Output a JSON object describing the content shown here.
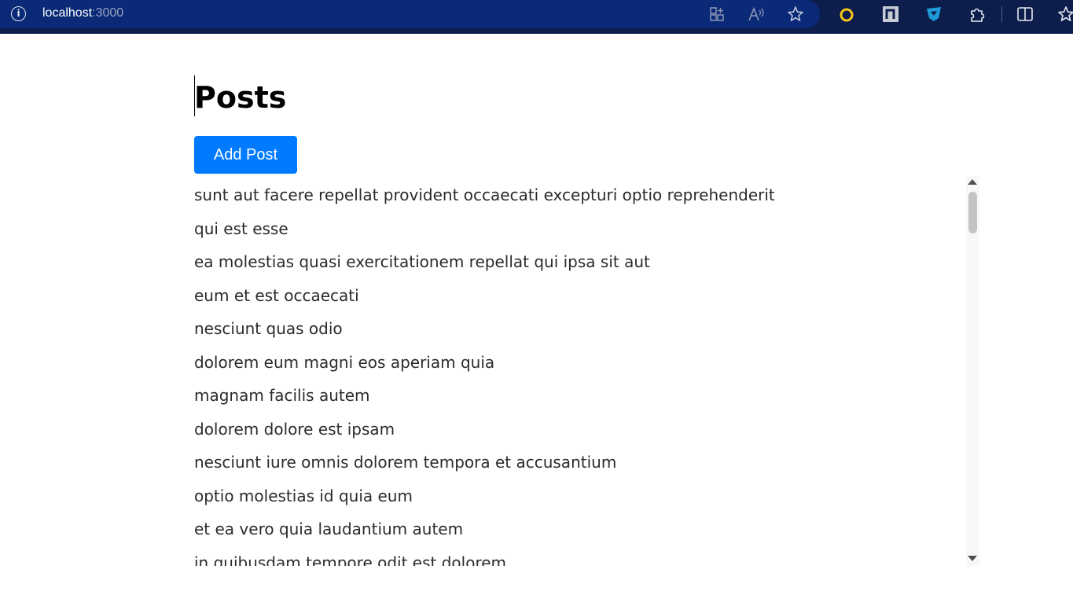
{
  "browser": {
    "url_host": "localhost",
    "url_port": ":3000",
    "info_icon": "i",
    "icons": [
      "split-screen-icon",
      "read-aloud-icon",
      "favorite-star-icon",
      "extension-ring-icon",
      "extension-n-icon",
      "extension-shield-icon",
      "extensions-puzzle-icon",
      "split-view-icon",
      "favorites-icon"
    ],
    "colors": {
      "bar": "#0d1e4d",
      "address": "#0a2a78"
    }
  },
  "page": {
    "title": "Posts",
    "add_button_label": "Add Post",
    "accent_color": "#007bff",
    "posts": [
      "sunt aut facere repellat provident occaecati excepturi optio reprehenderit",
      "qui est esse",
      "ea molestias quasi exercitationem repellat qui ipsa sit aut",
      "eum et est occaecati",
      "nesciunt quas odio",
      "dolorem eum magni eos aperiam quia",
      "magnam facilis autem",
      "dolorem dolore est ipsam",
      "nesciunt iure omnis dolorem tempora et accusantium",
      "optio molestias id quia eum",
      "et ea vero quia laudantium autem",
      "in quibusdam tempore odit est dolorem"
    ]
  }
}
